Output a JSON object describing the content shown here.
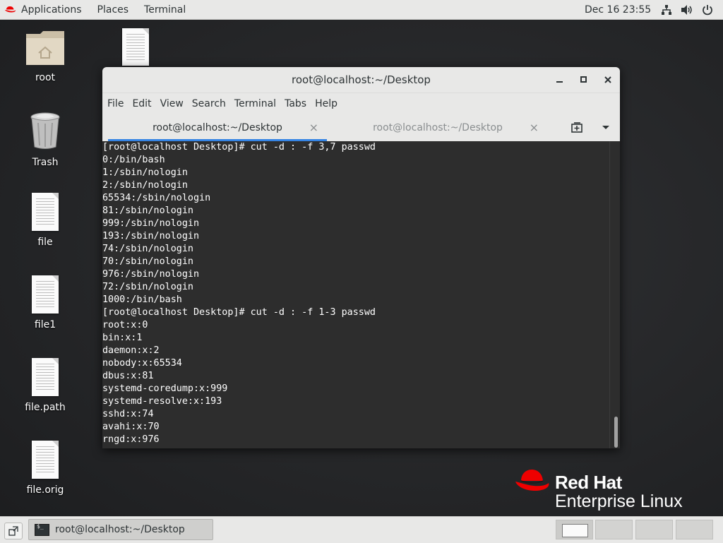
{
  "topbar": {
    "applications": "Applications",
    "places": "Places",
    "terminal": "Terminal",
    "clock": "Dec 16  23:55"
  },
  "desktop_icons": [
    {
      "label": "root",
      "icon": "home-folder-icon"
    },
    {
      "label": "Trash",
      "icon": "trash-icon"
    },
    {
      "label": "file",
      "icon": "text-file-icon"
    },
    {
      "label": "file1",
      "icon": "text-file-icon"
    },
    {
      "label": "file.path",
      "icon": "text-file-icon"
    },
    {
      "label": "file.orig",
      "icon": "text-file-icon"
    }
  ],
  "window": {
    "title": "root@localhost:~/Desktop",
    "menu": [
      "File",
      "Edit",
      "View",
      "Search",
      "Terminal",
      "Tabs",
      "Help"
    ],
    "tabs": [
      {
        "label": "root@localhost:~/Desktop",
        "active": true
      },
      {
        "label": "root@localhost:~/Desktop",
        "active": false
      }
    ],
    "close_glyph": "×",
    "lines": [
      "[root@localhost Desktop]# cut -d : -f 3,7 passwd",
      "0:/bin/bash",
      "1:/sbin/nologin",
      "2:/sbin/nologin",
      "65534:/sbin/nologin",
      "81:/sbin/nologin",
      "999:/sbin/nologin",
      "193:/sbin/nologin",
      "74:/sbin/nologin",
      "70:/sbin/nologin",
      "976:/sbin/nologin",
      "72:/sbin/nologin",
      "1000:/bin/bash",
      "[root@localhost Desktop]# cut -d : -f 1-3 passwd",
      "root:x:0",
      "bin:x:1",
      "daemon:x:2",
      "nobody:x:65534",
      "dbus:x:81",
      "systemd-coredump:x:999",
      "systemd-resolve:x:193",
      "sshd:x:74",
      "avahi:x:70",
      "rngd:x:976"
    ]
  },
  "branding": {
    "line1": "Red Hat",
    "line2": "Enterprise Linux"
  },
  "taskbar": {
    "task_label": "root@localhost:~/Desktop",
    "workspaces": 4,
    "active_workspace": 1
  },
  "colors": {
    "redhat_red": "#ee0000",
    "panel_bg": "#e8e8e7",
    "terminal_bg": "#2d2d2d",
    "tab_accent": "#3584e4"
  }
}
